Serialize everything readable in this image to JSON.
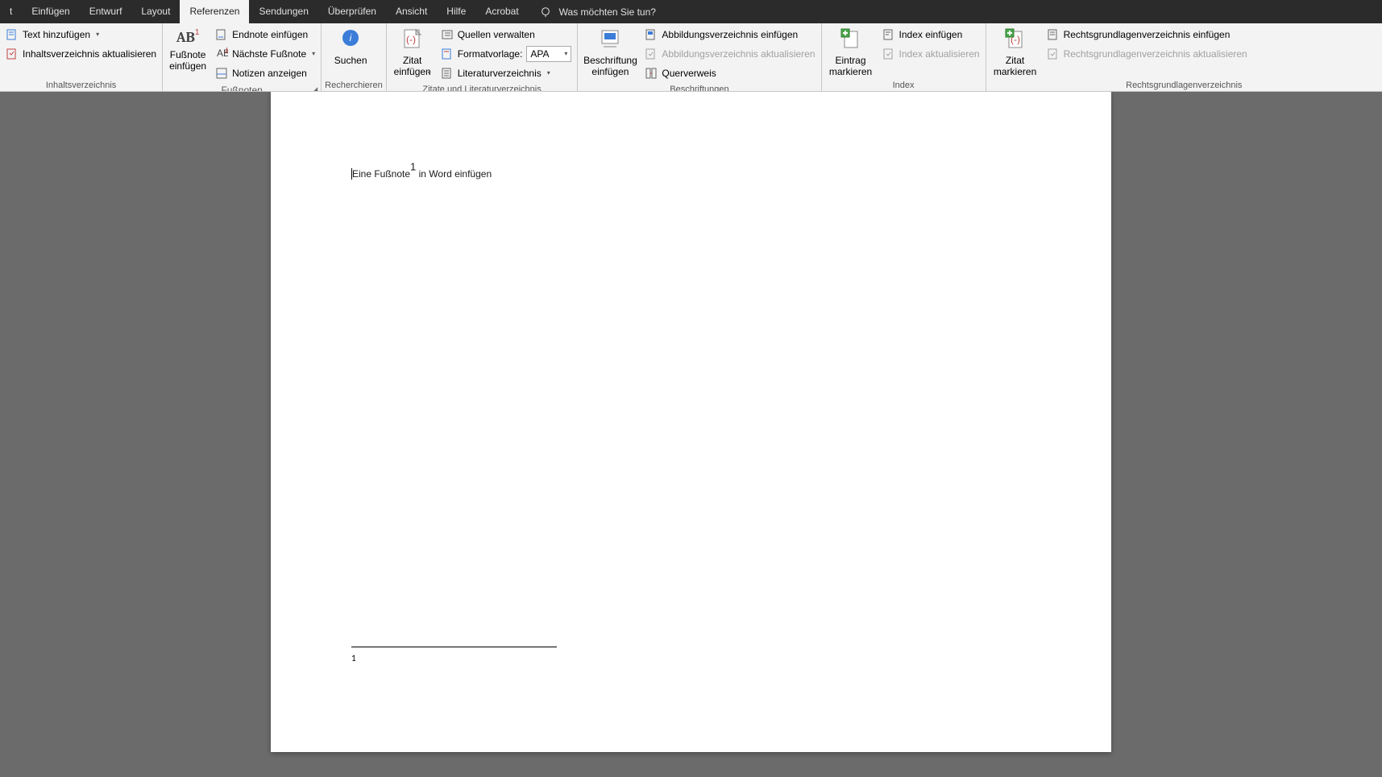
{
  "tabs": {
    "t0": "t",
    "t1": "Einfügen",
    "t2": "Entwurf",
    "t3": "Layout",
    "t4": "Referenzen",
    "t5": "Sendungen",
    "t6": "Überprüfen",
    "t7": "Ansicht",
    "t8": "Hilfe",
    "t9": "Acrobat",
    "tellme": "Was möchten Sie tun?"
  },
  "ribbon": {
    "toc": {
      "add_text": "Text hinzufügen",
      "update_toc": "Inhaltsverzeichnis aktualisieren",
      "group": "Inhaltsverzeichnis"
    },
    "footnotes": {
      "insert_footnote": "Fußnote\neinfügen",
      "ab": "AB",
      "sup": "1",
      "insert_endnote": "Endnote einfügen",
      "next_footnote": "Nächste Fußnote",
      "show_notes": "Notizen anzeigen",
      "group": "Fußnoten"
    },
    "research": {
      "search": "Suchen",
      "group": "Recherchieren"
    },
    "citations": {
      "insert_citation": "Zitat\neinfügen",
      "manage_sources": "Quellen verwalten",
      "style_label": "Formatvorlage:",
      "style_value": "APA",
      "bibliography": "Literaturverzeichnis",
      "group": "Zitate und Literaturverzeichnis"
    },
    "captions": {
      "insert_caption": "Beschriftung\neinfügen",
      "insert_figtable": "Abbildungsverzeichnis einfügen",
      "update_figtable": "Abbildungsverzeichnis aktualisieren",
      "crossref": "Querverweis",
      "group": "Beschriftungen"
    },
    "index": {
      "mark_entry": "Eintrag\nmarkieren",
      "insert_index": "Index einfügen",
      "update_index": "Index aktualisieren",
      "group": "Index"
    },
    "toa": {
      "mark_citation": "Zitat\nmarkieren",
      "insert_toa": "Rechtsgrundlagenverzeichnis einfügen",
      "update_toa": "Rechtsgrundlagenverzeichnis aktualisieren",
      "group": "Rechtsgrundlagenverzeichnis"
    }
  },
  "document": {
    "text_before": "Eine Fußnote",
    "footnote_mark": "1",
    "text_after": " in Word einfügen",
    "footnote_number": "1"
  }
}
